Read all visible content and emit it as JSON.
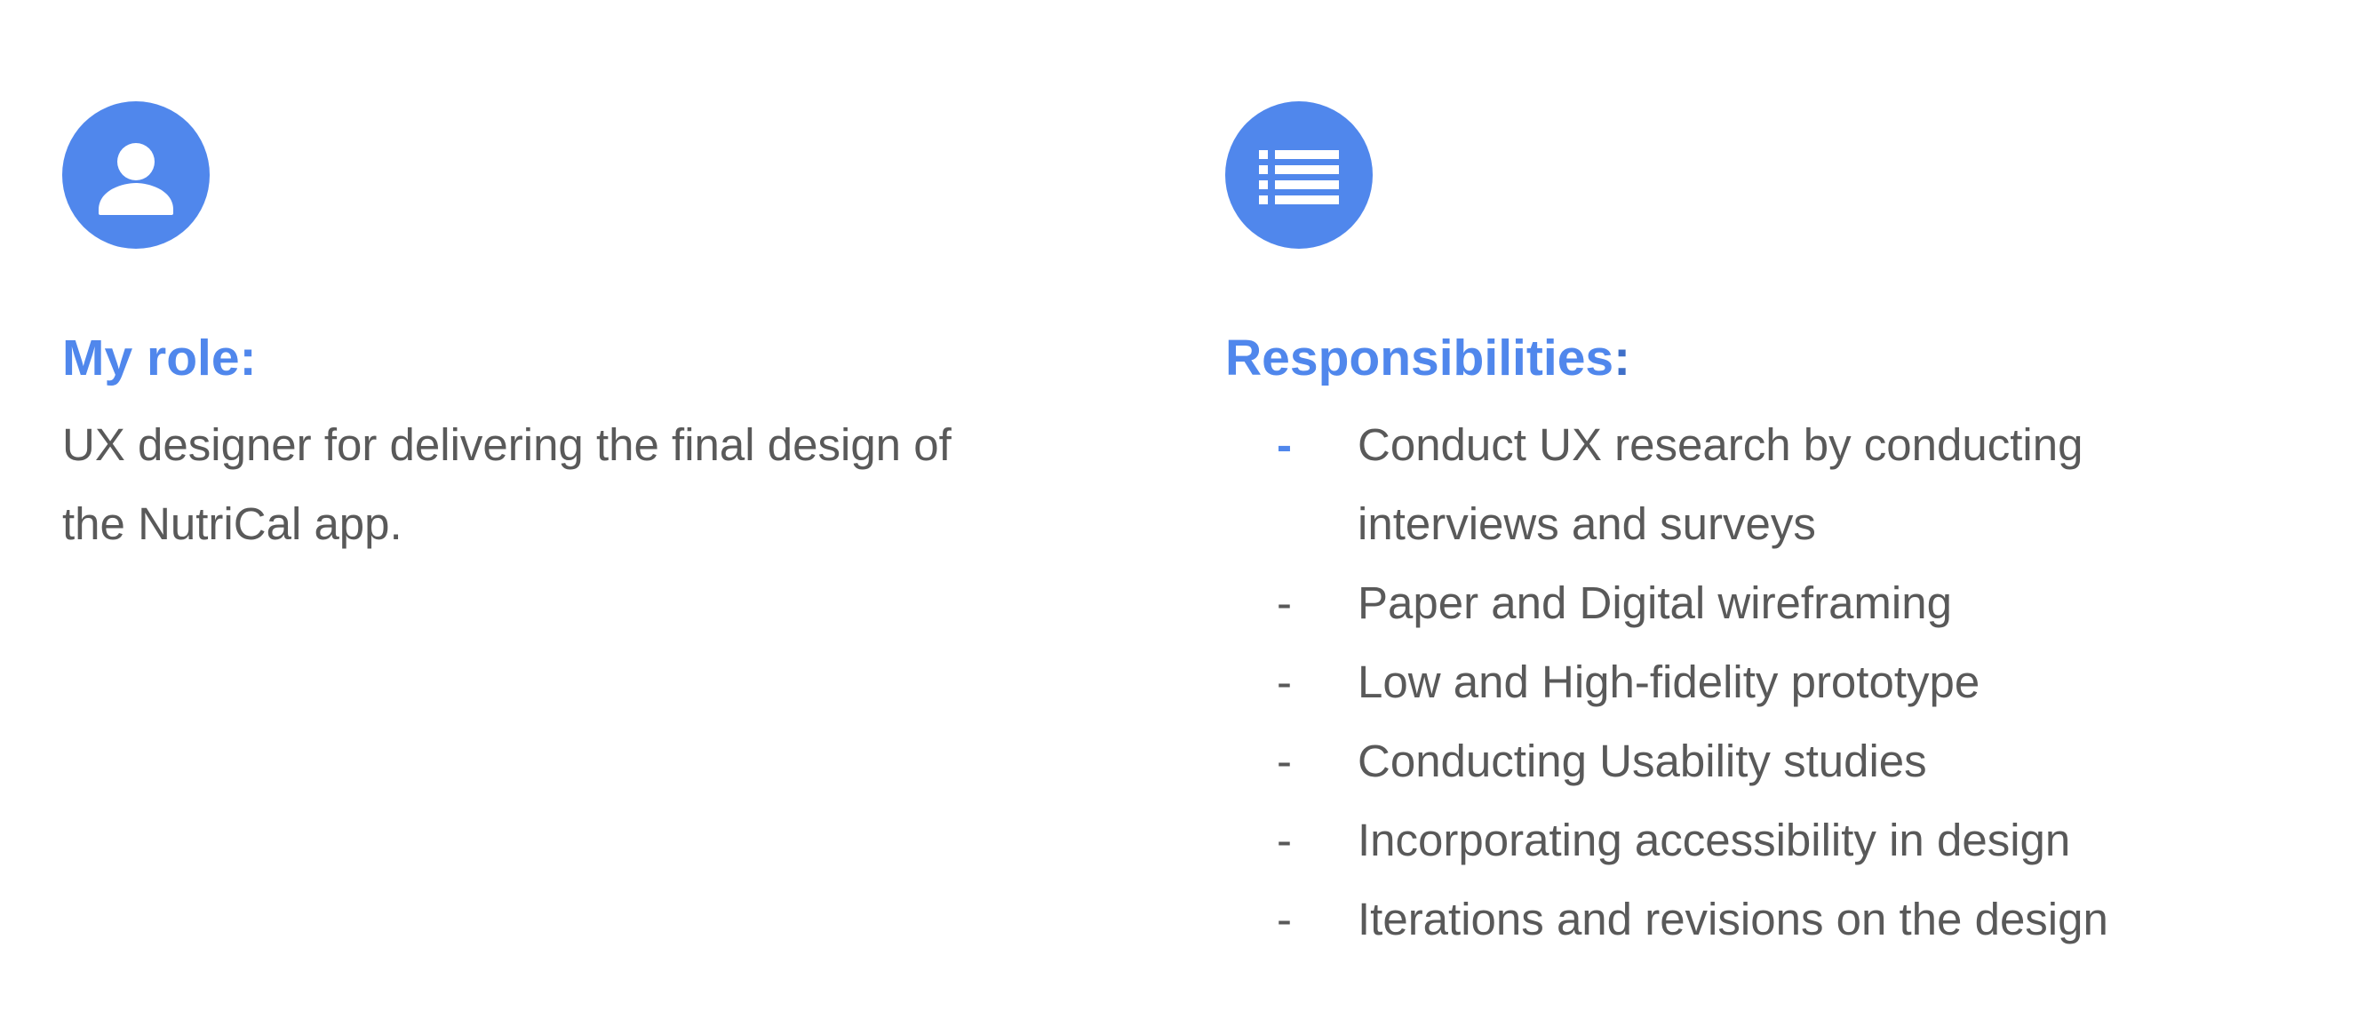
{
  "role": {
    "icon": "person-icon",
    "heading": "My role",
    "heading_colon": ":",
    "text": "UX designer for delivering the final design of the NutriCal app."
  },
  "responsibilities": {
    "icon": "list-icon",
    "heading": "Responsibilities",
    "heading_colon": ":",
    "bullet": "-",
    "items": [
      "Conduct UX research by conducting interviews and surveys",
      "Paper and Digital wireframing",
      "Low and High-fidelity prototype",
      "Conducting Usability studies",
      "Incorporating accessibility in design",
      "Iterations and revisions on the design"
    ]
  },
  "colors": {
    "accent": "#5087ec",
    "body_text": "#595959",
    "background": "#ffffff"
  }
}
